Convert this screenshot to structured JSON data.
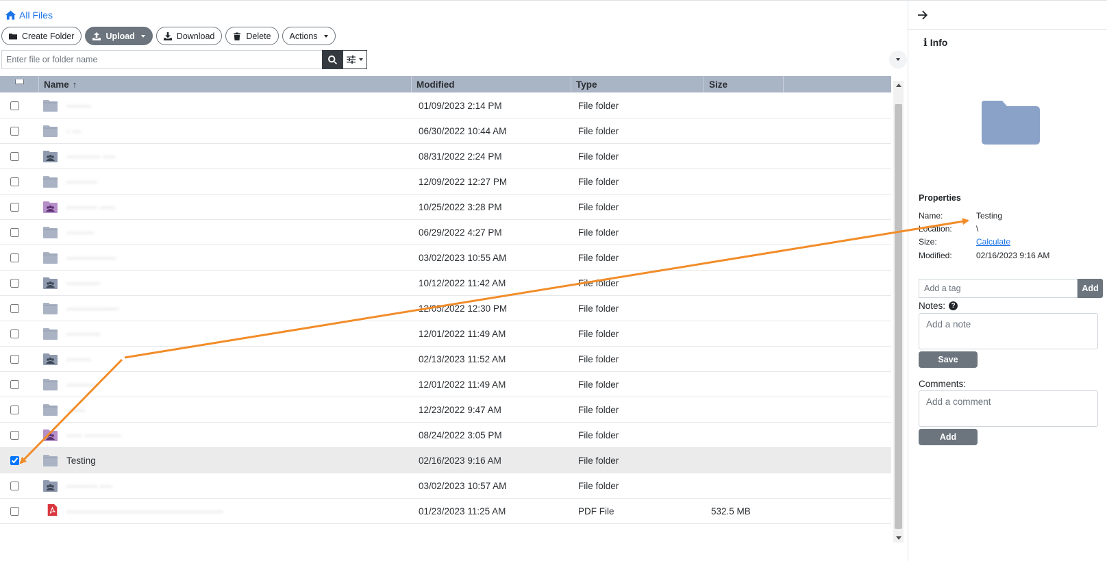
{
  "breadcrumb": {
    "label": "All Files"
  },
  "toolbar": {
    "create_folder": "Create Folder",
    "upload": "Upload",
    "download": "Download",
    "delete": "Delete",
    "actions": "Actions"
  },
  "search": {
    "placeholder": "Enter file or folder name"
  },
  "grid": {
    "columns": {
      "name": "Name",
      "modified": "Modified",
      "type": "Type",
      "size": "Size"
    },
    "rows": [
      {
        "name": "········",
        "modified": "01/09/2023 2:14 PM",
        "type": "File folder",
        "size": "",
        "icon": "folder-icon",
        "blurred": true
      },
      {
        "name": "· ···",
        "modified": "06/30/2022 10:44 AM",
        "type": "File folder",
        "size": "",
        "icon": "folder-icon",
        "blurred": true
      },
      {
        "name": "··········· ····",
        "modified": "08/31/2022 2:24 PM",
        "type": "File folder",
        "size": "",
        "icon": "shared-folder-icon",
        "blurred": true
      },
      {
        "name": "··········",
        "modified": "12/09/2022 12:27 PM",
        "type": "File folder",
        "size": "",
        "icon": "folder-icon",
        "blurred": true
      },
      {
        "name": "·········· ·····",
        "modified": "10/25/2022 3:28 PM",
        "type": "File folder",
        "size": "",
        "icon": "team-folder-icon",
        "blurred": true
      },
      {
        "name": "·········",
        "modified": "06/29/2022 4:27 PM",
        "type": "File folder",
        "size": "",
        "icon": "folder-icon",
        "blurred": true
      },
      {
        "name": "················",
        "modified": "03/02/2023 10:55 AM",
        "type": "File folder",
        "size": "",
        "icon": "folder-icon",
        "blurred": true
      },
      {
        "name": "···········",
        "modified": "10/12/2022 11:42 AM",
        "type": "File folder",
        "size": "",
        "icon": "shared-folder-icon",
        "blurred": true
      },
      {
        "name": "·················",
        "modified": "12/05/2022 12:30 PM",
        "type": "File folder",
        "size": "",
        "icon": "folder-icon",
        "blurred": true
      },
      {
        "name": "···········",
        "modified": "12/01/2022 11:49 AM",
        "type": "File folder",
        "size": "",
        "icon": "folder-icon",
        "blurred": true
      },
      {
        "name": "········",
        "modified": "02/13/2023 11:52 AM",
        "type": "File folder",
        "size": "",
        "icon": "shared-folder-icon",
        "blurred": true
      },
      {
        "name": "··········",
        "modified": "12/01/2022 11:49 AM",
        "type": "File folder",
        "size": "",
        "icon": "folder-icon",
        "blurred": true
      },
      {
        "name": "······",
        "modified": "12/23/2022 9:47 AM",
        "type": "File folder",
        "size": "",
        "icon": "folder-icon",
        "blurred": true
      },
      {
        "name": "····· ············",
        "modified": "08/24/2022 3:05 PM",
        "type": "File folder",
        "size": "",
        "icon": "team-folder-icon",
        "blurred": true
      },
      {
        "name": "Testing",
        "modified": "02/16/2023 9:16 AM",
        "type": "File folder",
        "size": "",
        "icon": "folder-icon",
        "blurred": false,
        "selected": true
      },
      {
        "name": "·········· ····",
        "modified": "03/02/2023 10:57 AM",
        "type": "File folder",
        "size": "",
        "icon": "shared-folder-icon",
        "blurred": true
      },
      {
        "name": "···················································",
        "modified": "01/23/2023 11:25 AM",
        "type": "PDF File",
        "size": "532.5 MB",
        "icon": "pdf-icon",
        "blurred": true
      }
    ]
  },
  "panel": {
    "title": "Info",
    "properties_title": "Properties",
    "properties": {
      "name_label": "Name:",
      "name_value": "Testing",
      "location_label": "Location:",
      "location_value": "\\",
      "size_label": "Size:",
      "size_value": "Calculate",
      "modified_label": "Modified:",
      "modified_value": "02/16/2023 9:16 AM"
    },
    "tag_placeholder": "Add a tag",
    "tag_add": "Add",
    "notes_label": "Notes:",
    "notes_placeholder": "Add a note",
    "notes_save": "Save",
    "comments_label": "Comments:",
    "comments_placeholder": "Add a comment",
    "comments_add": "Add"
  },
  "colors": {
    "accent": "#1a73e8",
    "header_bg": "#a9b4c5",
    "folder": "#aab3c4",
    "team_folder": "#b48fc8",
    "pdf": "#d9363e",
    "annotation": "#f28c28"
  }
}
